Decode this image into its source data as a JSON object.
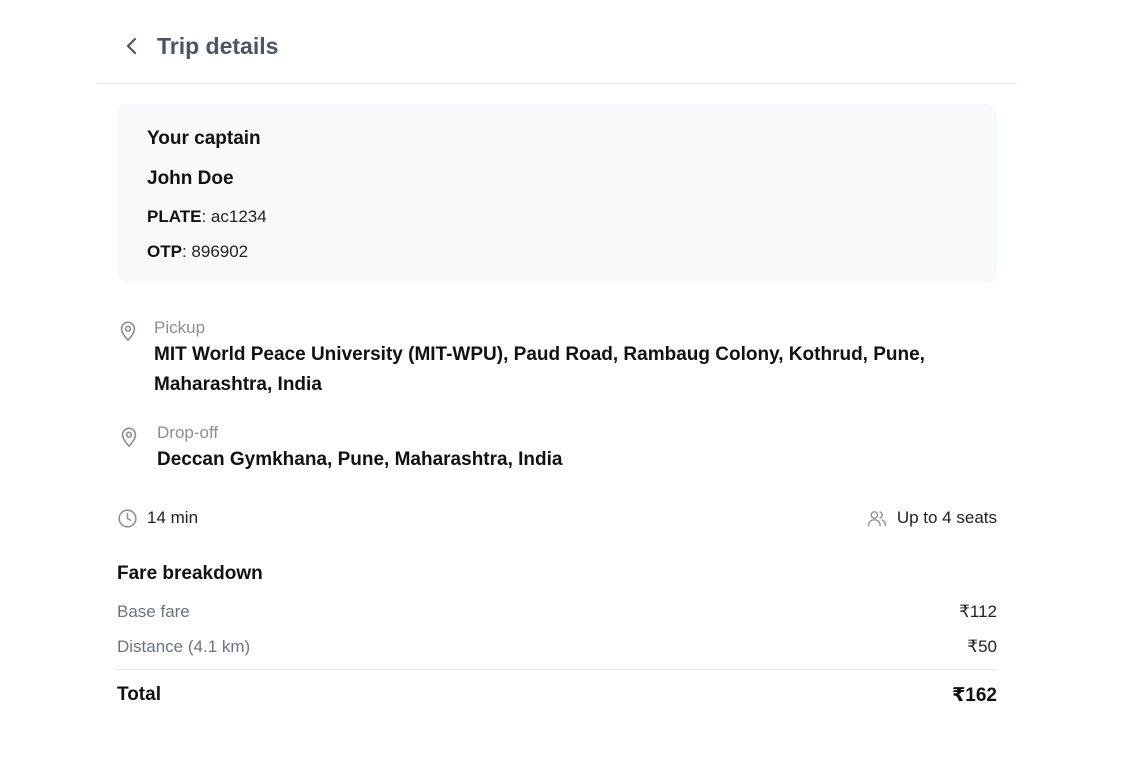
{
  "header": {
    "title": "Trip details",
    "back_icon": "chevron-left-icon"
  },
  "captain": {
    "heading": "Your captain",
    "name": "John Doe",
    "plate_label": "PLATE",
    "plate_value": "ac1234",
    "otp_label": "OTP",
    "otp_value": "896902"
  },
  "pickup": {
    "label": "Pickup",
    "address_line1": "MIT World Peace University (MIT-WPU), Paud Road, Rambaug Colony, Kothrud, Pune,",
    "address_line2": "Maharashtra, India",
    "icon": "map-pin-icon"
  },
  "dropoff": {
    "label": "Drop-off",
    "address": "Deccan Gymkhana, Pune, Maharashtra, India",
    "icon": "map-pin-icon"
  },
  "trip_meta": {
    "duration": "14 min",
    "duration_icon": "clock-icon",
    "seats": "Up to 4 seats",
    "seats_icon": "users-icon"
  },
  "fare": {
    "heading": "Fare breakdown",
    "rows": [
      {
        "label": "Base fare",
        "value": "₹112"
      },
      {
        "label": "Distance (4.1 km)",
        "value": "₹50"
      }
    ],
    "total_label": "Total",
    "total_value": "₹162"
  },
  "colors": {
    "title": "#4b5563",
    "card_bg": "#f8f9fa",
    "muted": "#8a8f98",
    "divider": "#e6e7ea"
  }
}
